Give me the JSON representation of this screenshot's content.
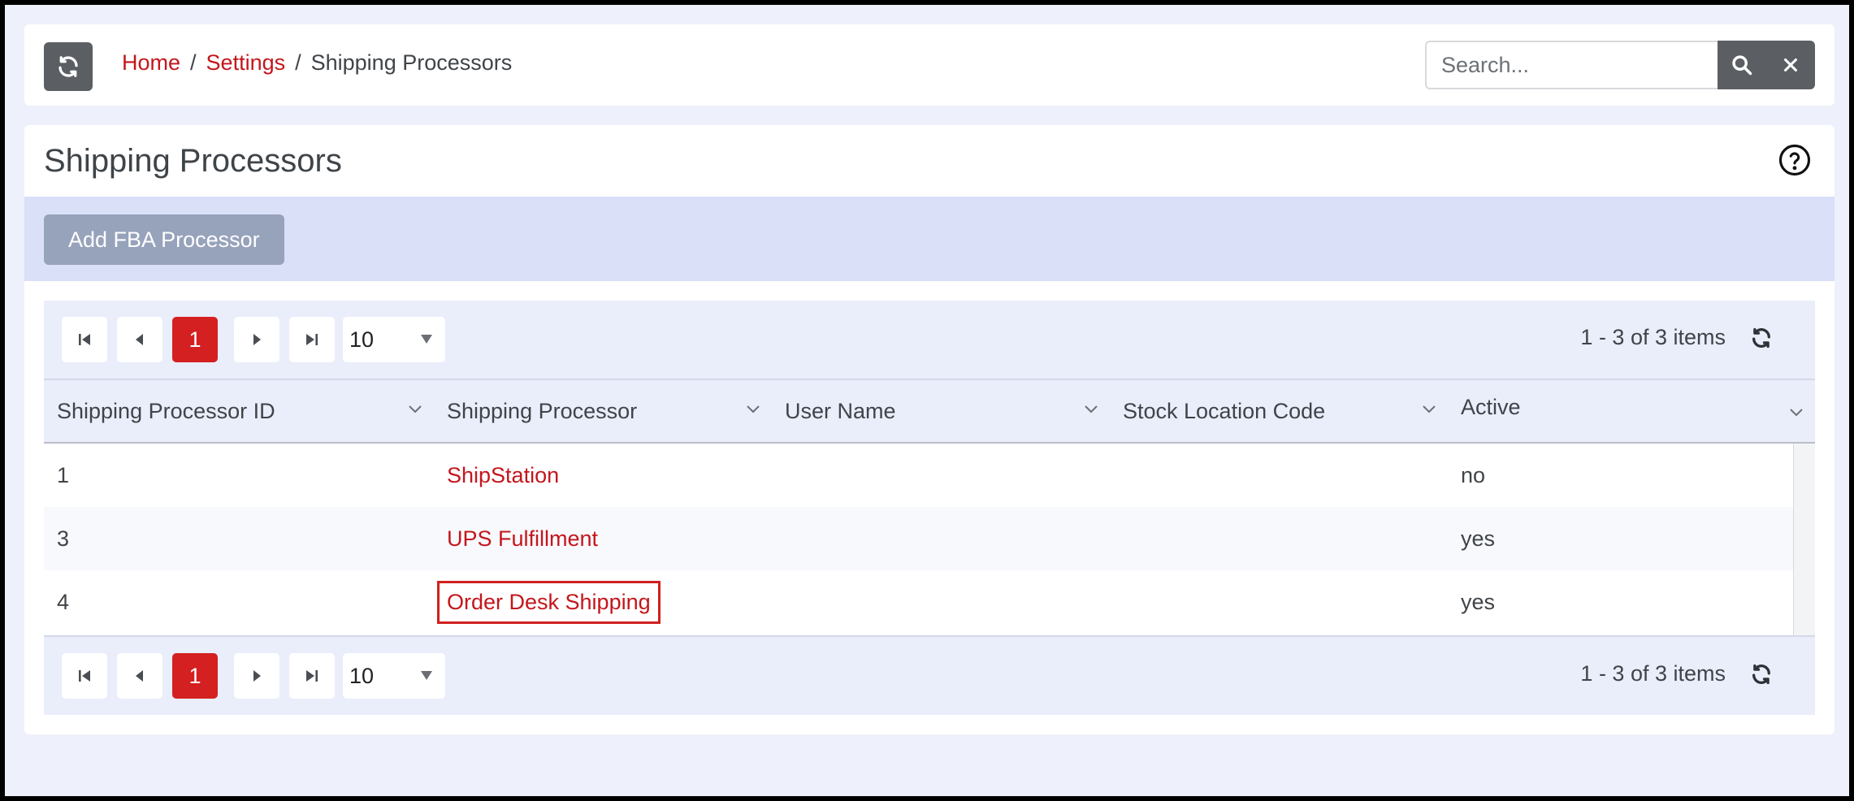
{
  "breadcrumb": {
    "home": "Home",
    "settings": "Settings",
    "current": "Shipping Processors"
  },
  "search": {
    "placeholder": "Search..."
  },
  "panel": {
    "title": "Shipping Processors",
    "add_button": "Add FBA Processor"
  },
  "pager": {
    "current_page": "1",
    "page_size": "10",
    "info": "1 - 3 of 3 items"
  },
  "columns": [
    "Shipping Processor ID",
    "Shipping Processor",
    "User Name",
    "Stock Location Code",
    "Active"
  ],
  "rows": [
    {
      "id": "1",
      "processor": "ShipStation",
      "user_name": "",
      "stock_location": "",
      "active": "no"
    },
    {
      "id": "3",
      "processor": "UPS Fulfillment",
      "user_name": "",
      "stock_location": "",
      "active": "yes"
    },
    {
      "id": "4",
      "processor": "Order Desk Shipping",
      "user_name": "",
      "stock_location": "",
      "active": "yes"
    }
  ],
  "colors": {
    "accent": "#c4161c",
    "active_page": "#d42020",
    "toolbar_bg": "#d9e0f7",
    "button_dark": "#5b5f63"
  },
  "icons": [
    "refresh-icon",
    "search-icon",
    "close-icon",
    "help-icon",
    "first-page-icon",
    "prev-page-icon",
    "next-page-icon",
    "last-page-icon",
    "chevron-down-icon"
  ]
}
